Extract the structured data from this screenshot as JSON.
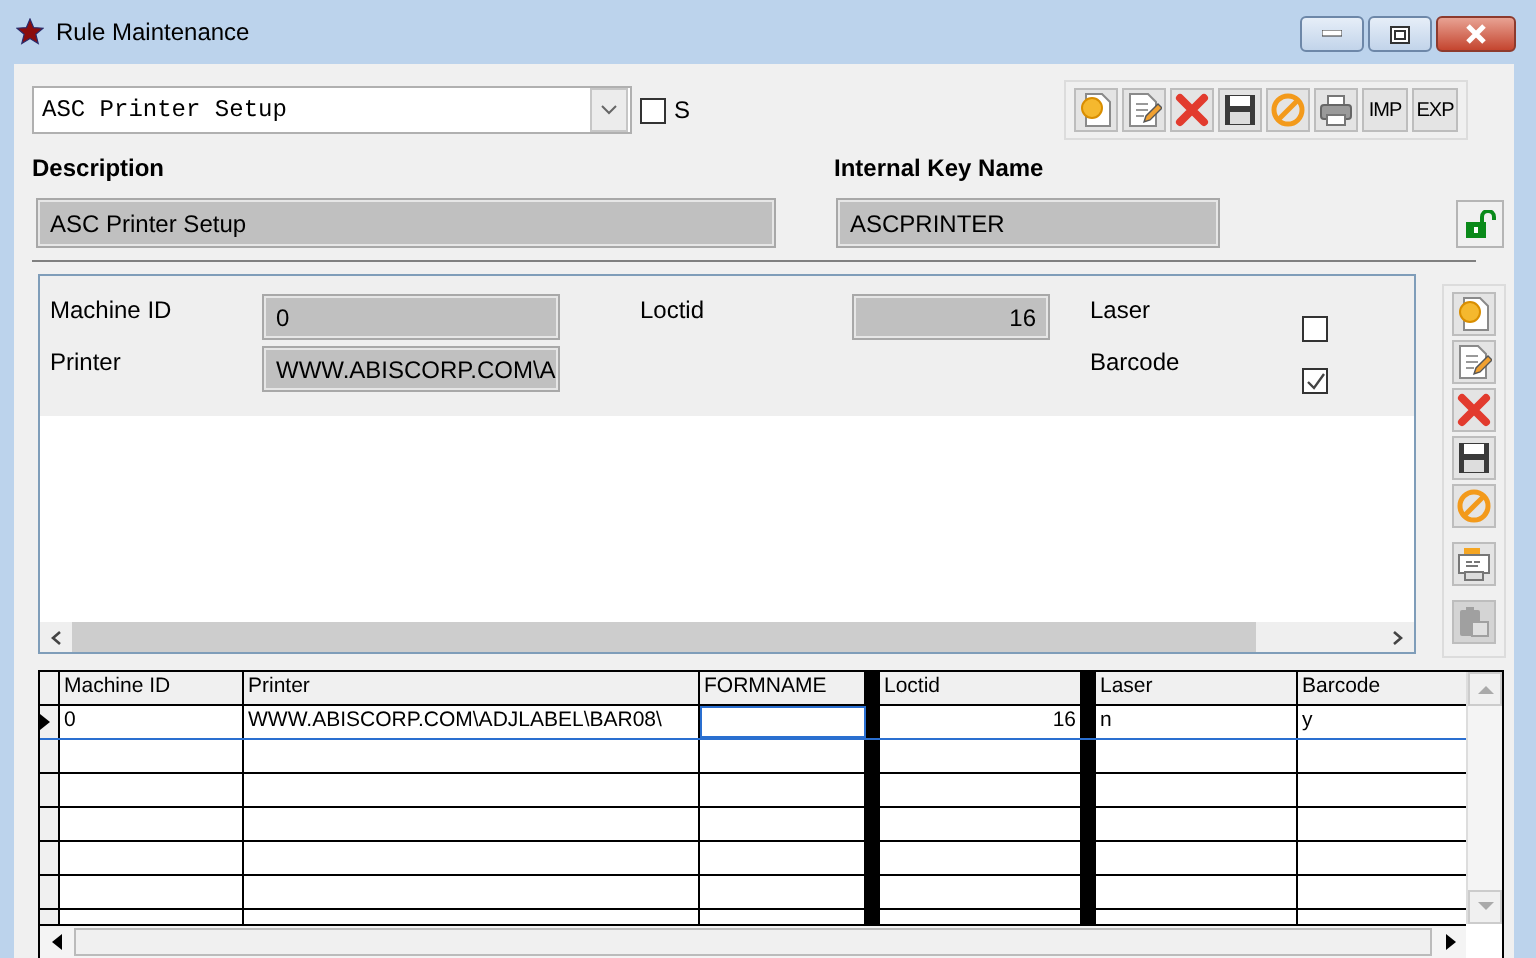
{
  "window": {
    "title": "Rule Maintenance"
  },
  "rule_select": {
    "value": "ASC Printer Setup"
  },
  "s_checkbox": {
    "label": "S",
    "checked": false
  },
  "toolbar": [
    {
      "kind": "new"
    },
    {
      "kind": "edit"
    },
    {
      "kind": "delete"
    },
    {
      "kind": "save"
    },
    {
      "kind": "cancel"
    },
    {
      "kind": "print"
    },
    {
      "kind": "text",
      "label": "IMP"
    },
    {
      "kind": "text",
      "label": "EXP"
    }
  ],
  "description": {
    "label": "Description",
    "value": "ASC Printer Setup"
  },
  "internal_key": {
    "label": "Internal Key Name",
    "value": "ASCPRINTER"
  },
  "detail": {
    "machine_id": {
      "label": "Machine ID",
      "value": "0"
    },
    "printer": {
      "label": "Printer",
      "value": "WWW.ABISCORP.COM\\A"
    },
    "loctid": {
      "label": "Loctid",
      "value": "16"
    },
    "laser": {
      "label": "Laser",
      "checked": false
    },
    "barcode": {
      "label": "Barcode",
      "checked": true
    }
  },
  "side_toolbar": [
    {
      "kind": "new",
      "disabled": false
    },
    {
      "kind": "edit",
      "disabled": false
    },
    {
      "kind": "delete",
      "disabled": false
    },
    {
      "kind": "save",
      "disabled": false
    },
    {
      "kind": "cancel",
      "disabled": false
    },
    {
      "kind": "report",
      "disabled": false
    },
    {
      "kind": "paste",
      "disabled": true
    }
  ],
  "grid": {
    "columns": [
      {
        "label": "Machine ID",
        "kind": "plain"
      },
      {
        "label": "Printer",
        "kind": "plain"
      },
      {
        "label": "FORMNAME",
        "kind": "plain"
      },
      {
        "label": "Loctid",
        "kind": "divided"
      },
      {
        "label": "Laser",
        "kind": "divided"
      },
      {
        "label": "Barcode",
        "kind": "plain"
      }
    ],
    "rows": [
      {
        "selected": true,
        "cells": [
          "0",
          "WWW.ABISCORP.COM\\ADJLABEL\\BAR08\\",
          null,
          "16",
          "n",
          "y"
        ]
      }
    ]
  }
}
